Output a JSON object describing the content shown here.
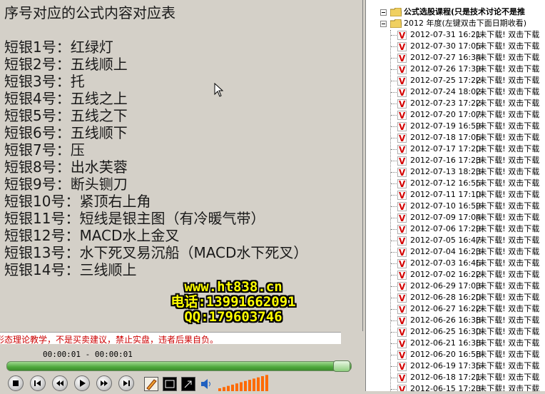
{
  "video": {
    "title": "序号对应的公式内容对应表",
    "lines": [
      "短银1号：红绿灯",
      "短银2号：五线顺上",
      "短银3号：托",
      "短银4号：五线之上",
      "短银5号：五线之下",
      "短银6号：五线顺下",
      "短银7号：压",
      "短银8号：出水芙蓉",
      "短银9号：断头铡刀",
      "短银10号：紧顶右上角",
      "短银11号：短线是银主图（有冷暖气带）",
      "短银12号：MACD水上金叉",
      "短银13号：水下死叉易沉船（MACD水下死叉）",
      "短银14号：三线顺上"
    ],
    "watermark": {
      "www": "www.ht838.cn",
      "phone": "电话:13991662091",
      "qq": "QQ:179603746"
    }
  },
  "ticker": {
    "text": "形态理论教学，不是买卖建议，禁止实盘，违者后果自负。"
  },
  "player": {
    "time": "00:00:01 - 00:00:01",
    "progress_fraction": 0.97,
    "buttons": [
      "stop",
      "previous",
      "rewind",
      "play",
      "fast-forward",
      "next"
    ],
    "volume_level": 1.0
  },
  "tree": {
    "root_label": "公式选股课程(只是技术讨论不是推",
    "year_label": "2012 年度(左键双击下面日期收看)",
    "item_suffix": "[未下载! 双击下载",
    "items": [
      "2012-07-31 16:21",
      "2012-07-30 17:05",
      "2012-07-27 16:34",
      "2012-07-26 17:39",
      "2012-07-25 17:22",
      "2012-07-24 18:02",
      "2012-07-23 17:22",
      "2012-07-20 17:07",
      "2012-07-19 16:59",
      "2012-07-18 17:06",
      "2012-07-17 17:20",
      "2012-07-16 17:23",
      "2012-07-13 18:23",
      "2012-07-12 16:55",
      "2012-07-11 17:10",
      "2012-07-10 16:59",
      "2012-07-09 17:04",
      "2012-07-06 17:29",
      "2012-07-05 16:47",
      "2012-07-04 16:23",
      "2012-07-03 16:46",
      "2012-07-02 16:22",
      "2012-06-29 17:03",
      "2012-06-28 16:20",
      "2012-06-27 16:22",
      "2012-06-26 16:38",
      "2012-06-25 16:30",
      "2012-06-21 16:38",
      "2012-06-20 16:58",
      "2012-06-19 17:35",
      "2012-06-18 17:21",
      "2012-06-15 17:23"
    ]
  },
  "colors": {
    "ticker_text": "#cc0000",
    "watermark": "#ffff00",
    "v_icon": "#d40000"
  }
}
